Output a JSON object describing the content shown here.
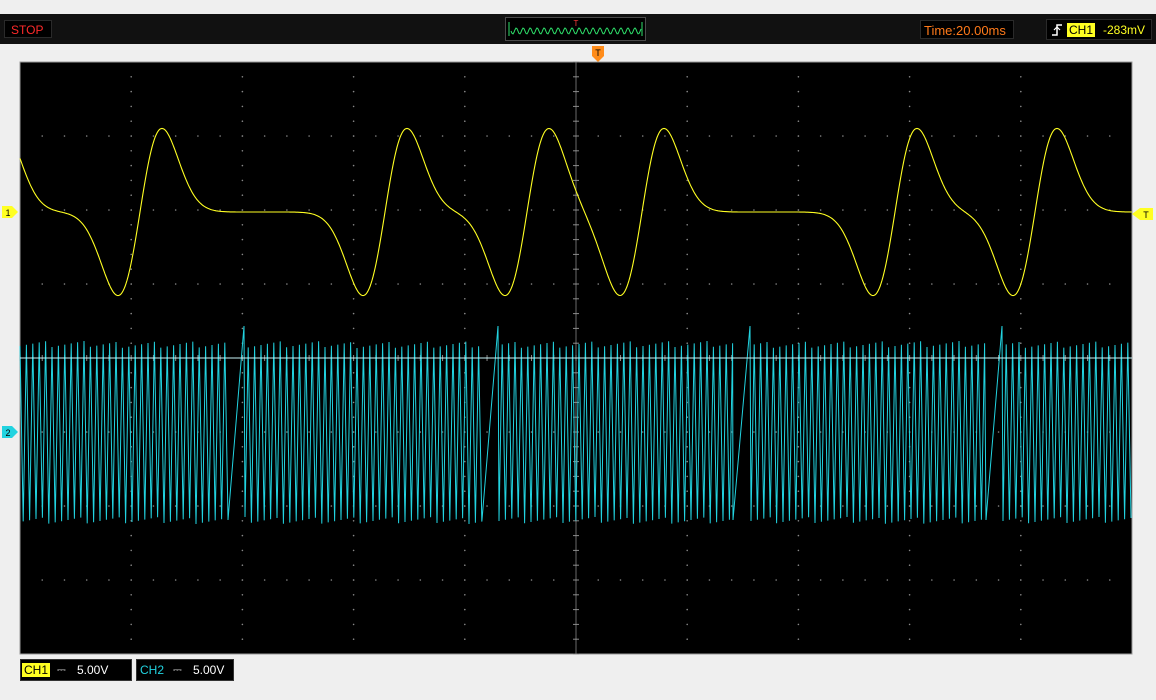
{
  "status": {
    "run_state": "STOP"
  },
  "overview": {
    "trigger_marker": "T"
  },
  "timebase": {
    "label": "Time:20.00ms"
  },
  "trigger": {
    "edge_icon": "rising-edge-icon",
    "source": "CH1",
    "level": "-283mV",
    "marker_label": "T"
  },
  "channels": [
    {
      "id": "CH1",
      "marker": "1",
      "coupling": "⎓",
      "volts_per_div": "5.00V",
      "color": "#ffff22"
    },
    {
      "id": "CH2",
      "marker": "2",
      "coupling": "⎓",
      "volts_per_div": "5.00V",
      "color": "#22d3e0"
    }
  ],
  "colors": {
    "grid": "#888888",
    "trigger_marker": "#ff8c1a",
    "background": "#000000"
  }
}
